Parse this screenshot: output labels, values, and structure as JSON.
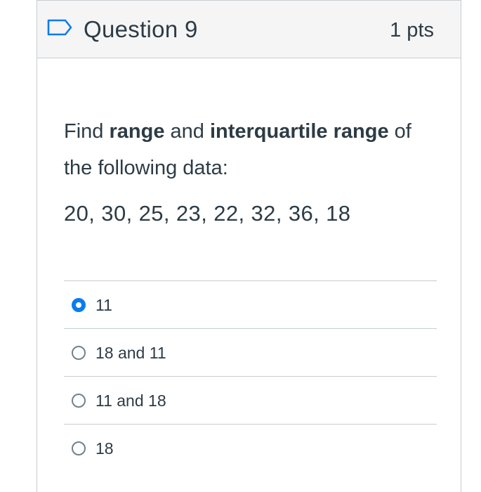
{
  "question": {
    "title": "Question 9",
    "points": "1 pts",
    "prompt_parts": {
      "p1": "Find ",
      "p2": "range",
      "p3": " and ",
      "p4": "interquartile range",
      "p5": " of the following data:"
    },
    "data_values": "20, 30, 25, 23, 22, 32, 36, 18"
  },
  "answers": [
    {
      "label": "11",
      "selected": true
    },
    {
      "label": "18 and 11",
      "selected": false
    },
    {
      "label": "11 and 18",
      "selected": false
    },
    {
      "label": "18",
      "selected": false
    }
  ],
  "colors": {
    "accent": "#0b7bf0",
    "text": "#2d3b45",
    "header_bg": "#f5f5f5",
    "border": "#c7cdd1"
  },
  "icons": {
    "flag": "bookmark-flag-icon"
  }
}
